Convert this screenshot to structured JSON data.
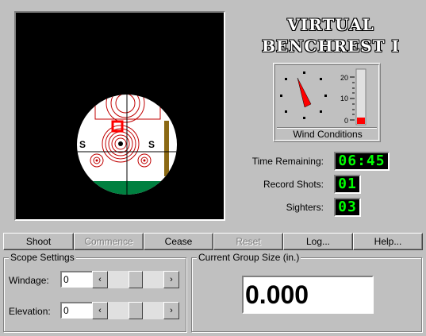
{
  "title": {
    "line1": "VIRTUAL",
    "line2": "BENCHREST I"
  },
  "wind": {
    "label": "Wind Conditions",
    "scale": [
      "20",
      "10",
      "0"
    ],
    "level_fraction": 0.12,
    "arrow_direction": "north-west",
    "colors": {
      "arrow": "#ff0000",
      "bar": "#ff0000"
    }
  },
  "target": {
    "sighter_markers": [
      "S",
      "S"
    ],
    "colors": {
      "band": "#008040",
      "post": "#8b6914",
      "sight_mark": "#ff0000"
    }
  },
  "info": {
    "time_label": "Time Remaining:",
    "time_value": "06:45",
    "record_label": "Record Shots:",
    "record_value": "01",
    "sighters_label": "Sighters:",
    "sighters_value": "03"
  },
  "buttons": {
    "shoot": "Shoot",
    "commence": "Commence",
    "cease": "Cease",
    "reset": "Reset",
    "log": "Log...",
    "help": "Help..."
  },
  "scope_settings": {
    "title": "Scope Settings",
    "windage_label": "Windage:",
    "windage_value": "0",
    "elevation_label": "Elevation:",
    "elevation_value": "0",
    "left_arrow": "‹",
    "right_arrow": "›"
  },
  "group": {
    "title": "Current Group Size (in.)",
    "value": "0.000"
  }
}
